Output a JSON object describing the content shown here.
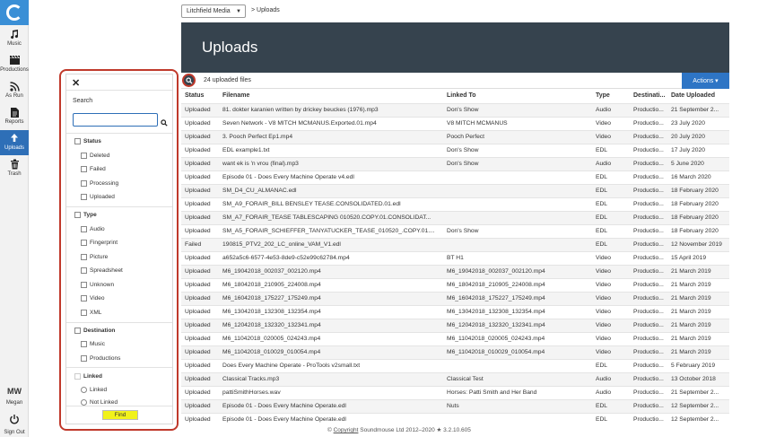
{
  "nav": {
    "items": [
      {
        "label": "Music",
        "icon": "music-note-icon"
      },
      {
        "label": "Productions",
        "icon": "clapperboard-icon"
      },
      {
        "label": "As Run",
        "icon": "broadcast-icon"
      },
      {
        "label": "Reports",
        "icon": "report-icon"
      },
      {
        "label": "Uploads",
        "icon": "upload-icon"
      },
      {
        "label": "Trash",
        "icon": "trash-icon"
      }
    ],
    "user_initials": "MW",
    "user_name": "Megan",
    "signout_label": "Sign Out"
  },
  "breadcrumb": {
    "company": "Litchfield Media",
    "separator": ">",
    "current": "Uploads"
  },
  "header": {
    "title": "Uploads"
  },
  "toolbar": {
    "count_text": "24 uploaded files",
    "actions_label": "Actions ▾"
  },
  "filter": {
    "close": "✕",
    "search_label": "Search",
    "search_value": "",
    "status": {
      "label": "Status",
      "options": [
        "Deleted",
        "Failed",
        "Processing",
        "Uploaded"
      ]
    },
    "type": {
      "label": "Type",
      "options": [
        "Audio",
        "Fingerprint",
        "Picture",
        "Spreadsheet",
        "Unknown",
        "Video",
        "XML"
      ]
    },
    "destination": {
      "label": "Destination",
      "options": [
        "Music",
        "Productions"
      ]
    },
    "linked": {
      "label": "Linked",
      "options": [
        "Linked",
        "Not Linked"
      ]
    },
    "find_label": "Find"
  },
  "table": {
    "columns": [
      "Status",
      "Filename",
      "Linked To",
      "Type",
      "Destinati...",
      "Date Uploaded"
    ],
    "rows": [
      [
        "Uploaded",
        "81. dokter karanien written by drickey beuckes (1976).mp3",
        "Don's Show",
        "Audio",
        "Productio...",
        "21 September 2..."
      ],
      [
        "Uploaded",
        "Seven Network - V8 MITCH MCMANUS.Exported.01.mp4",
        "V8 MITCH MCMANUS",
        "Video",
        "Productio...",
        "23 July 2020"
      ],
      [
        "Uploaded",
        "3. Pooch Perfect Ep1.mp4",
        "Pooch Perfect",
        "Video",
        "Productio...",
        "20 July 2020"
      ],
      [
        "Uploaded",
        "EDL example1.txt",
        "Don's Show",
        "EDL",
        "Productio...",
        "17 July 2020"
      ],
      [
        "Uploaded",
        "want ek is 'n vrou (final).mp3",
        "Don's Show",
        "Audio",
        "Productio...",
        "5 June 2020"
      ],
      [
        "Uploaded",
        "Episode 01 - Does Every Machine Operate v4.edl",
        "",
        "EDL",
        "Productio...",
        "16 March 2020"
      ],
      [
        "Uploaded",
        "SM_D4_CU_ALMANAC.edl",
        "",
        "EDL",
        "Productio...",
        "18 February 2020"
      ],
      [
        "Uploaded",
        "SM_A9_FORAIR_BILL BENSLEY TEASE.CONSOLIDATED.01.edl",
        "",
        "EDL",
        "Productio...",
        "18 February 2020"
      ],
      [
        "Uploaded",
        "SM_A7_FORAIR_TEASE TABLESCAPING 010520.COPY.01.CONSOLIDAT...",
        "",
        "EDL",
        "Productio...",
        "18 February 2020"
      ],
      [
        "Uploaded",
        "SM_A5_FORAIR_SCHIEFFER_TANYATUCKER_TEASE_010520_.COPY.01....",
        "Don's Show",
        "EDL",
        "Productio...",
        "18 February 2020"
      ],
      [
        "Failed",
        "190815_PTV2_202_LC_online_VAM_V1.edl",
        "",
        "EDL",
        "Productio...",
        "12 November 2019"
      ],
      [
        "Uploaded",
        "a652a5c6-6577-4e53-8de9-c52e99c62784.mp4",
        "BT H1",
        "Video",
        "Productio...",
        "15 April 2019"
      ],
      [
        "Uploaded",
        "M6_19042018_002037_002120.mp4",
        "M6_19042018_002037_002120.mp4",
        "Video",
        "Productio...",
        "21 March 2019"
      ],
      [
        "Uploaded",
        "M6_18042018_210905_224008.mp4",
        "M6_18042018_210905_224008.mp4",
        "Video",
        "Productio...",
        "21 March 2019"
      ],
      [
        "Uploaded",
        "M6_16042018_175227_175249.mp4",
        "M6_16042018_175227_175249.mp4",
        "Video",
        "Productio...",
        "21 March 2019"
      ],
      [
        "Uploaded",
        "M6_13042018_132308_132354.mp4",
        "M6_13042018_132308_132354.mp4",
        "Video",
        "Productio...",
        "21 March 2019"
      ],
      [
        "Uploaded",
        "M6_12042018_132320_132341.mp4",
        "M6_12042018_132320_132341.mp4",
        "Video",
        "Productio...",
        "21 March 2019"
      ],
      [
        "Uploaded",
        "M6_11042018_020005_024243.mp4",
        "M6_11042018_020005_024243.mp4",
        "Video",
        "Productio...",
        "21 March 2019"
      ],
      [
        "Uploaded",
        "M6_11042018_010029_010054.mp4",
        "M6_11042018_010029_010054.mp4",
        "Video",
        "Productio...",
        "21 March 2019"
      ],
      [
        "Uploaded",
        "Does Every Machine Operate - ProTools v2small.txt",
        "",
        "EDL",
        "Productio...",
        "5 February 2019"
      ],
      [
        "Uploaded",
        "Classical Tracks.mp3",
        "Classical Test",
        "Audio",
        "Productio...",
        "13 October 2018"
      ],
      [
        "Uploaded",
        "pattiSmithHorses.wav",
        "Horses: Patti Smith and Her Band",
        "Audio",
        "Productio...",
        "21 September 2..."
      ],
      [
        "Uploaded",
        "Episode 01 - Does Every Machine Operate.edl",
        "Nuts",
        "EDL",
        "Productio...",
        "12 September 2..."
      ],
      [
        "Uploaded",
        "Episode 01 - Does Every Machine Operate.edl",
        "",
        "EDL",
        "Productio...",
        "12 September 2..."
      ]
    ]
  },
  "footer": {
    "prefix": "© ",
    "link": "Copyright",
    "rest": " Soundmouse Ltd 2012–2020 ★ 3.2.10.605"
  },
  "colors": {
    "accent": "#2e75c5",
    "header_bg": "#36434e",
    "highlight_ring": "#c0392b",
    "find_button": "#f1f21b"
  }
}
